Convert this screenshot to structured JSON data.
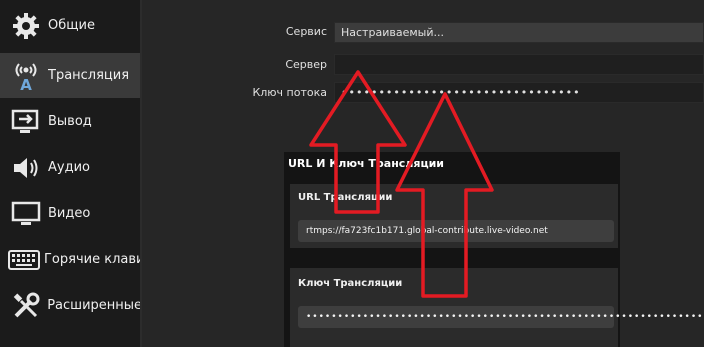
{
  "sidebar": {
    "items": [
      {
        "label": "Общие",
        "icon": "gear-icon"
      },
      {
        "label": "Трансляция",
        "icon": "broadcast-icon"
      },
      {
        "label": "Вывод",
        "icon": "output-icon"
      },
      {
        "label": "Аудио",
        "icon": "speaker-icon"
      },
      {
        "label": "Видео",
        "icon": "monitor-icon"
      },
      {
        "label": "Горячие клавиш",
        "icon": "keyboard-icon"
      },
      {
        "label": "Расширенные",
        "icon": "tools-icon"
      }
    ],
    "active_index": 1
  },
  "form": {
    "service_label": "Сервис",
    "service_value": "Настраиваемый...",
    "server_label": "Сервер",
    "server_value": "",
    "key_label": "Ключ потока",
    "key_value": "••••••••••••••••••••••••••••••••"
  },
  "overlay": {
    "title": "URL И Ключ Трансляции",
    "url_label": "URL Трансляции",
    "url_value": "rtmps://fa723fc1b171.global-contribute.live-video.net",
    "key_label": "Ключ Трансляции",
    "key_value": "••••••••••••••••••••••••••••••••••••••••••••••••••••••••••••••••"
  },
  "colors": {
    "arrow": "#e31b23",
    "sidebar_bg": "#1b1b1b",
    "active_bg": "#3a3a3a",
    "main_bg": "#262626"
  }
}
